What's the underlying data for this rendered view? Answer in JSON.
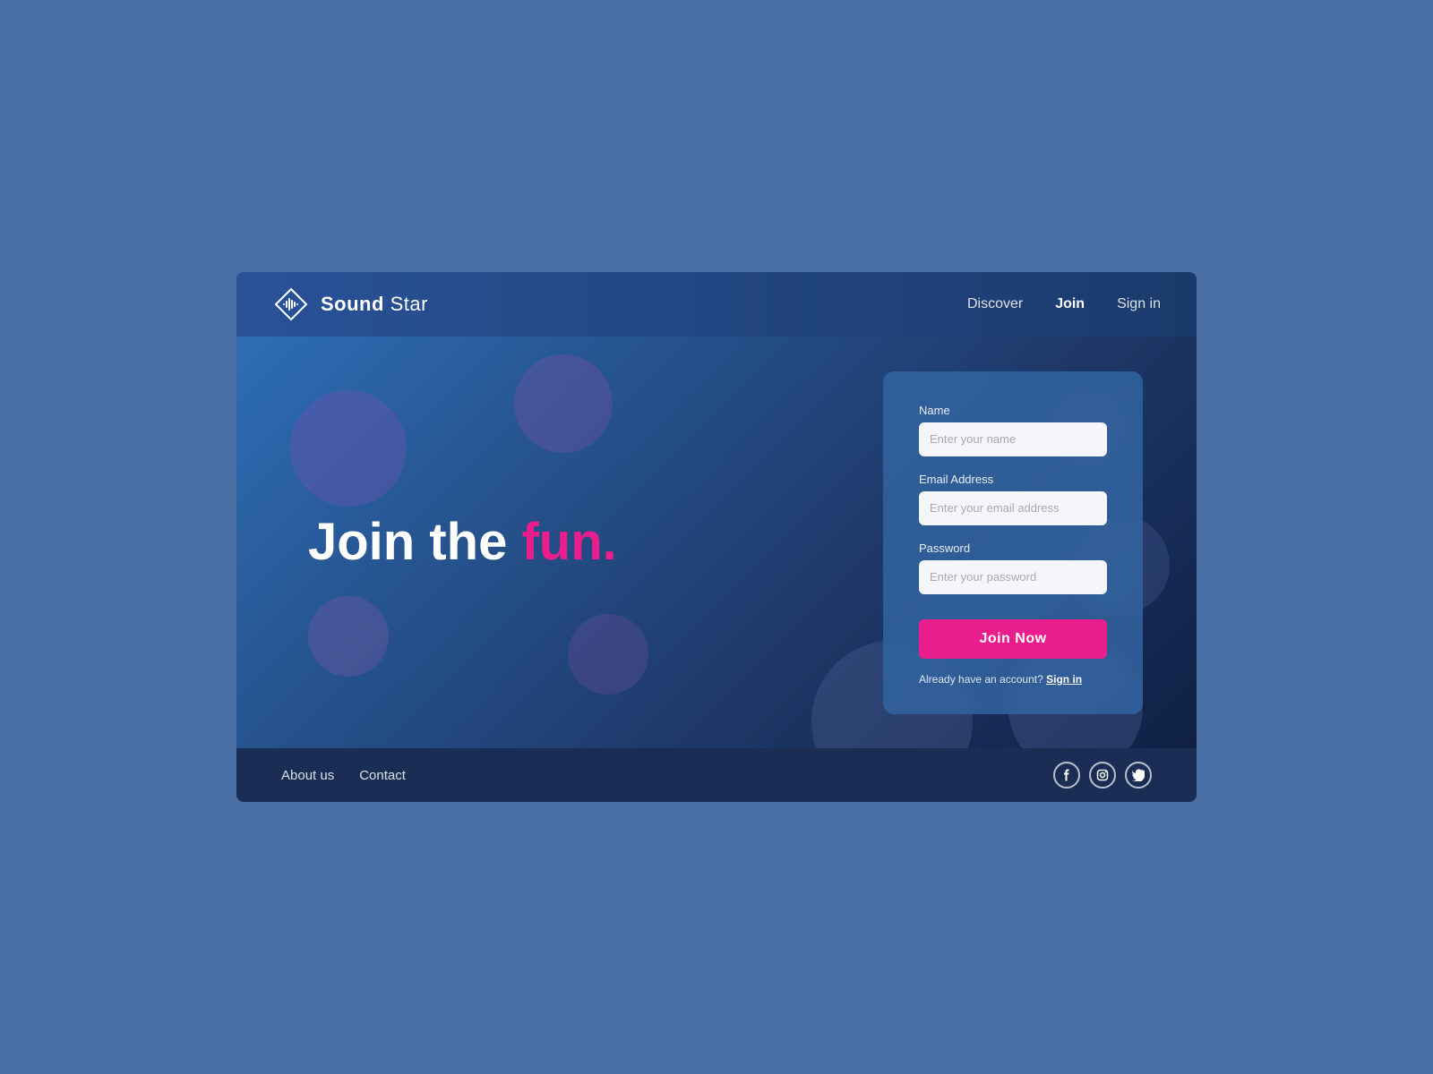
{
  "app": {
    "name": "Sound Star",
    "name_bold": "Sound",
    "name_regular": "Star"
  },
  "navbar": {
    "discover_label": "Discover",
    "join_label": "Join",
    "signin_label": "Sign in"
  },
  "hero": {
    "heading_static": "Join the ",
    "heading_highlight": "fun",
    "heading_dot": "."
  },
  "form": {
    "name_label": "Name",
    "name_placeholder": "Enter your name",
    "email_label": "Email Address",
    "email_placeholder": "Enter your email address",
    "password_label": "Password",
    "password_placeholder": "Enter your password",
    "join_button": "Join Now",
    "already_account": "Already have an account?",
    "signin_link": "Sign in"
  },
  "footer": {
    "about_label": "About us",
    "contact_label": "Contact"
  },
  "social": {
    "facebook": "f",
    "instagram": "◎",
    "twitter": "t"
  },
  "colors": {
    "accent": "#e91e8c",
    "bg_outer": "#4a6fa5",
    "bg_main": "#2e6db4",
    "nav_bg": "#1a3a6b",
    "footer_bg": "#1a2e55"
  }
}
